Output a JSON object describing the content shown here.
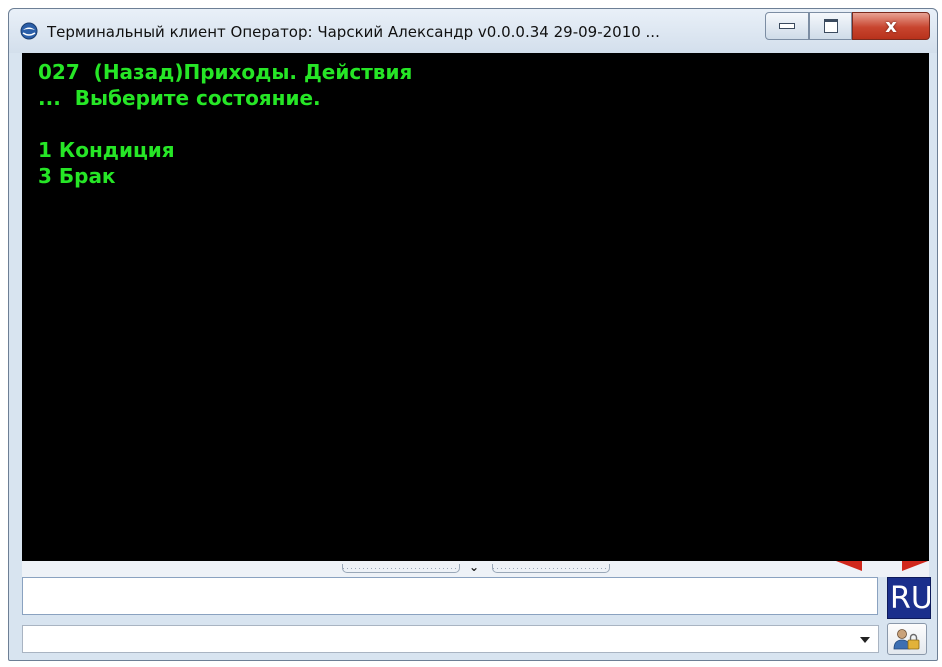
{
  "window": {
    "title": "Терминальный клиент Оператор: Чарский Александр v0.0.0.34 29-09-2010 ...",
    "close_glyph": "x",
    "icons": [
      "app-icon",
      "minimize-icon",
      "maximize-icon",
      "close-icon"
    ]
  },
  "terminal": {
    "lines": [
      "027  (Назад)Приходы. Действия",
      "...  Выберите состояние.",
      "",
      "1 Кондиция",
      "3 Брак"
    ],
    "text_color": "#26e626",
    "background": "#000000"
  },
  "input": {
    "value": "",
    "placeholder": ""
  },
  "language_indicator": "RU",
  "dropdown": {
    "selected": ""
  },
  "colors": {
    "accent_red": "#d0281c",
    "lang_bg": "#1a2f8c"
  }
}
